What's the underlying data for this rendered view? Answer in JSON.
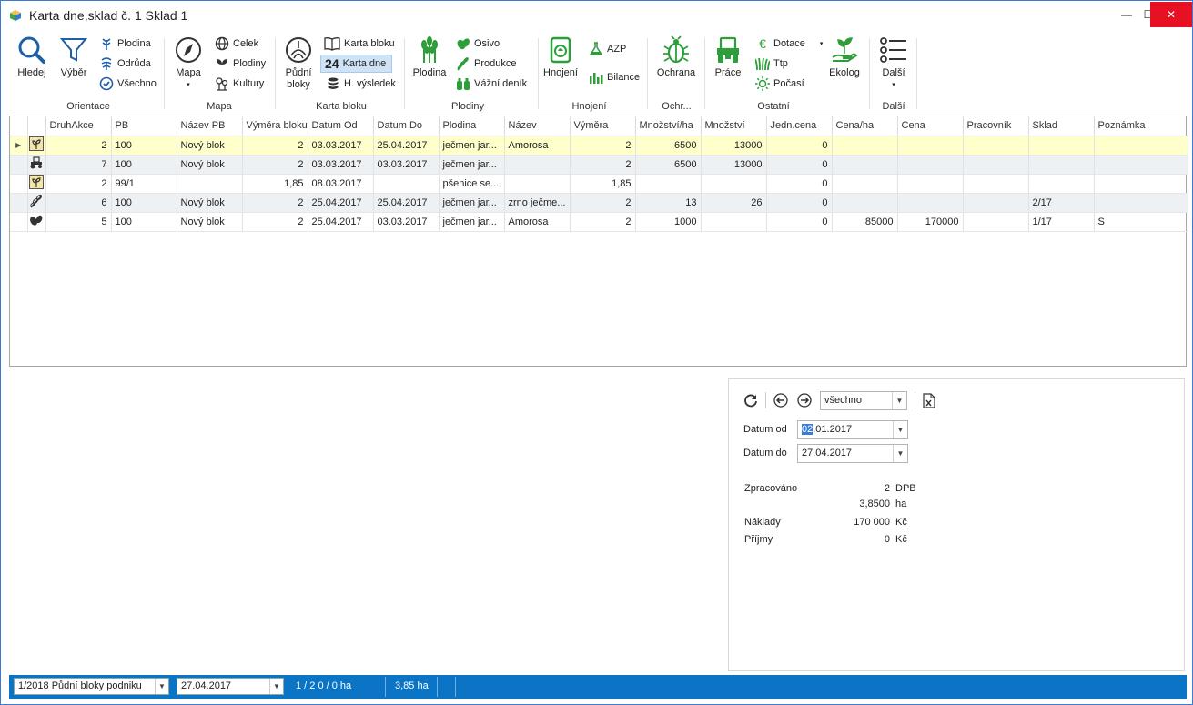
{
  "window": {
    "title": "Karta dne,sklad č. 1 Sklad 1",
    "minimize": "—",
    "maximize": "☐",
    "close": "✕"
  },
  "ribbon": {
    "hledej": "Hledej",
    "vyber": "Výběr",
    "plodina": "Plodina",
    "odruda": "Odrůda",
    "vsechno": "Všechno",
    "orientace_label": "Orientace",
    "mapa": "Mapa",
    "celek": "Celek",
    "plodiny": "Plodiny",
    "kultury": "Kultury",
    "mapa_label": "Mapa",
    "pudni_bloky_1": "Půdní",
    "pudni_bloky_2": "bloky",
    "karta_bloku": "Karta bloku",
    "karta_dne_num": "24",
    "karta_dne": "Karta dne",
    "h_vysledek": "H. výsledek",
    "karta_bloku_label": "Karta bloku",
    "plodina_big": "Plodina",
    "osivo": "Osivo",
    "produkce": "Produkce",
    "vazni_denik": "Vážní deník",
    "plodiny_label": "Plodiny",
    "hnojeni": "Hnojení",
    "azp": "AZP",
    "bilance": "Bilance",
    "hnojeni_label": "Hnojení",
    "ochrana": "Ochrana",
    "ochrana_label": "Ochr...",
    "prace": "Práce",
    "dotace": "Dotace",
    "ttp": "Ttp",
    "pocasi": "Počasí",
    "ekolog": "Ekolog",
    "ostatni_label": "Ostatní",
    "dalsi": "Další",
    "dalsi_label": "Další",
    "colors": {
      "green": "#2e9e3a",
      "blue": "#1f5fa8"
    }
  },
  "grid": {
    "columns": [
      "DruhAkce",
      "PB",
      "Název PB",
      "Výměra bloku",
      "Datum Od",
      "Datum Do",
      "Plodina",
      "Název",
      "Výměra",
      "Množství/ha",
      "Množství",
      "Jedn.cena",
      "Cena/ha",
      "Cena",
      "Pracovník",
      "Sklad",
      "Poznámka"
    ],
    "rows": [
      {
        "icon": "sprout-icon",
        "cells": [
          "2",
          "100",
          "Nový blok",
          "2",
          "03.03.2017",
          "25.04.2017",
          "ječmen jar...",
          "Amorosa",
          "2",
          "6500",
          "13000",
          "0",
          "",
          "",
          "",
          "",
          ""
        ]
      },
      {
        "icon": "tractor-icon",
        "cells": [
          "7",
          "100",
          "Nový blok",
          "2",
          "03.03.2017",
          "03.03.2017",
          "ječmen jar...",
          "",
          "2",
          "6500",
          "13000",
          "0",
          "",
          "",
          "",
          "",
          ""
        ]
      },
      {
        "icon": "sprout-icon",
        "cells": [
          "2",
          "99/1",
          "",
          "1,85",
          "08.03.2017",
          "",
          "pšenice se...",
          "",
          "1,85",
          "",
          "",
          "0",
          "",
          "",
          "",
          "",
          ""
        ]
      },
      {
        "icon": "grain-icon",
        "cells": [
          "6",
          "100",
          "Nový blok",
          "2",
          "25.04.2017",
          "25.04.2017",
          "ječmen jar...",
          "zrno ječme...",
          "2",
          "13",
          "26",
          "0",
          "",
          "",
          "",
          "2/17",
          ""
        ]
      },
      {
        "icon": "seeds-icon",
        "cells": [
          "5",
          "100",
          "Nový blok",
          "2",
          "25.04.2017",
          "03.03.2017",
          "ječmen jar...",
          "Amorosa",
          "2",
          "1000",
          "",
          "0",
          "85000",
          "170000",
          "",
          "1/17",
          "S"
        ]
      }
    ]
  },
  "panel": {
    "filter_value": "všechno",
    "datum_od_label": "Datum od",
    "datum_od_sel": "02",
    "datum_od_rest": ".01.2017",
    "datum_do_label": "Datum do",
    "datum_do_value": "27.04.2017",
    "zpracovano_label": "Zpracováno",
    "zpracovano_value": "2",
    "zpracovano_unit": "DPB",
    "ha_value": "3,8500",
    "ha_unit": "ha",
    "naklady_label": "Náklady",
    "naklady_value": "170 000",
    "naklady_unit": "Kč",
    "prijmy_label": "Příjmy",
    "prijmy_value": "0",
    "prijmy_unit": "Kč"
  },
  "statusbar": {
    "block_select": "1/2018 Půdní bloky podniku",
    "date_select": "27.04.2017",
    "counts": "1 / 2  0 / 0 ha",
    "area": "3,85 ha"
  }
}
